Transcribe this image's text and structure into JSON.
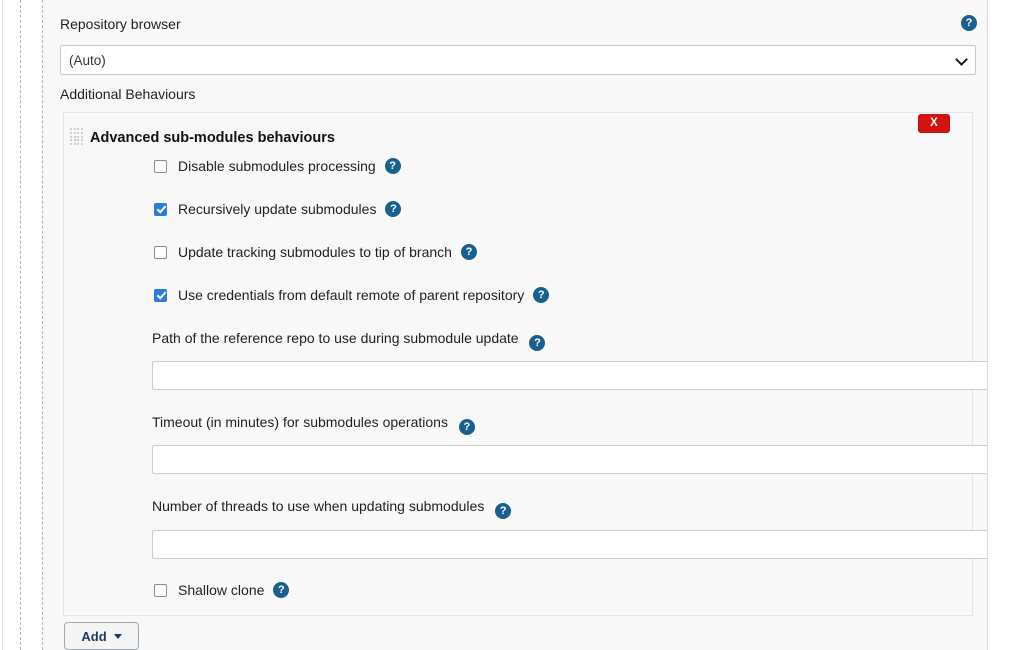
{
  "repository_browser": {
    "label": "Repository browser",
    "help_icon": "?",
    "selected_value": "(Auto)",
    "options": [
      "(Auto)"
    ],
    "caret_icon": "chevron-down-icon"
  },
  "additional_behaviours": {
    "label": "Additional Behaviours"
  },
  "panel": {
    "title": "Advanced sub-modules behaviours",
    "drag_handle_icon": "drag-grip-icon",
    "delete_label": "X",
    "delete_color": "#d3130f",
    "checkboxes": [
      {
        "label": "Disable submodules processing",
        "checked": false,
        "help_icon": "?"
      },
      {
        "label": "Recursively update submodules",
        "checked": true,
        "help_icon": "?"
      },
      {
        "label": "Update tracking submodules to tip of branch",
        "checked": false,
        "help_icon": "?"
      },
      {
        "label": "Use credentials from default remote of parent repository",
        "checked": true,
        "help_icon": "?"
      }
    ],
    "fields": [
      {
        "label": "Path of the reference repo to use during submodule update",
        "value": "",
        "placeholder": "",
        "help_icon": "?"
      },
      {
        "label": "Timeout (in minutes) for submodules operations",
        "value": "",
        "placeholder": "",
        "help_icon": "?"
      },
      {
        "label": "Number of threads to use when updating submodules",
        "value": "",
        "placeholder": "",
        "help_icon": "?"
      }
    ],
    "shallow_clone": {
      "label": "Shallow clone",
      "checked": false,
      "help_icon": "?"
    }
  },
  "add_button": {
    "label": "Add",
    "caret_icon": "caret-down-icon"
  },
  "colors": {
    "help_blue": "#19608f",
    "checkbox_blue": "#2b7cd3",
    "danger_red": "#d3130f",
    "panel_bg": "#f8f8f8",
    "add_text": "#1c3a5e"
  }
}
